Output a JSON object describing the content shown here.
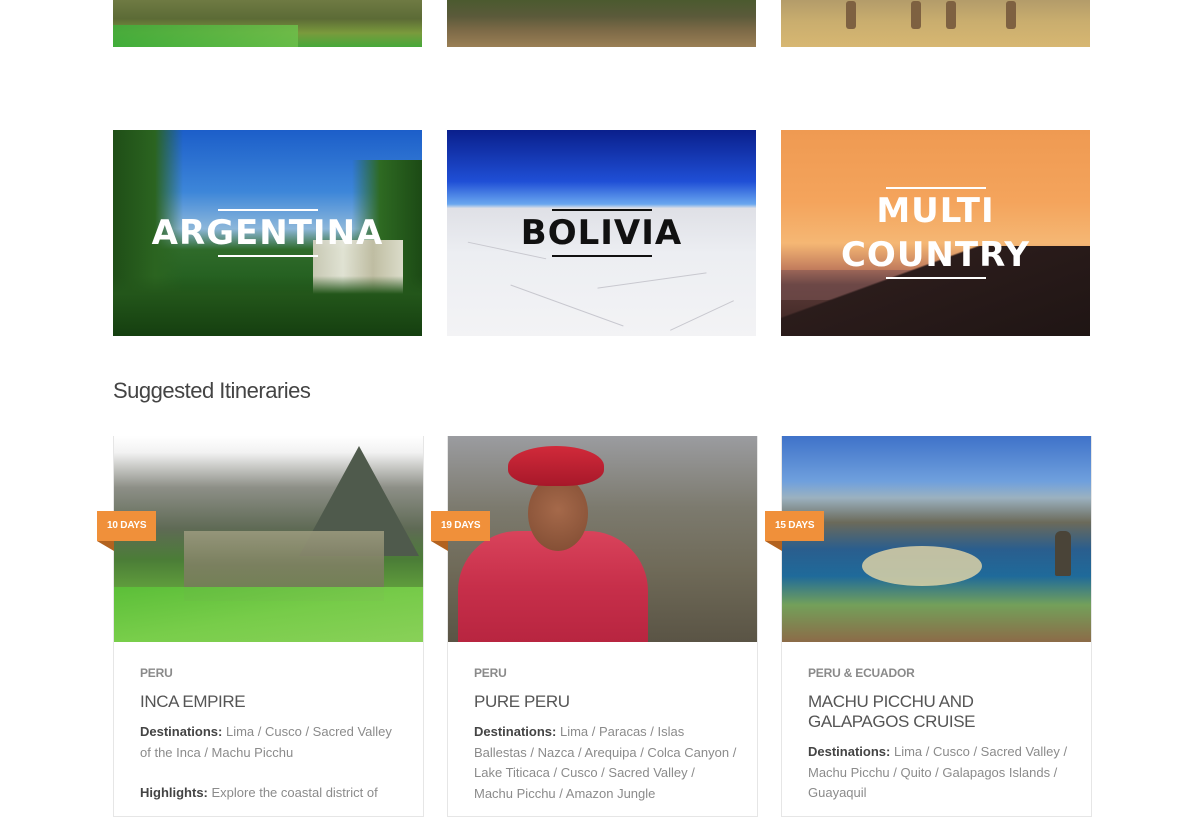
{
  "destinations": [
    {
      "name": "ARGENTINA"
    },
    {
      "name": "BOLIVIA"
    },
    {
      "name": "MULTI COUNTRY"
    }
  ],
  "section_title": "Suggested Itineraries",
  "itineraries": [
    {
      "days": "10 DAYS",
      "region": "PERU",
      "title": "INCA EMPIRE",
      "destinations_label": "Destinations:",
      "destinations": "Lima / Cusco / Sacred Valley of the Inca / Machu Picchu",
      "highlights_label": "Highlights:",
      "highlights": "Explore the coastal district of"
    },
    {
      "days": "19 DAYS",
      "region": "PERU",
      "title": "PURE PERU",
      "destinations_label": "Destinations:",
      "destinations": "Lima / Paracas / Islas Ballestas / Nazca / Arequipa / Colca Canyon / Lake Titicaca / Cusco / Sacred Valley / Machu Picchu / Amazon Jungle"
    },
    {
      "days": "15 DAYS",
      "region": "PERU & ECUADOR",
      "title": "MACHU PICCHU AND GALAPAGOS CRUISE",
      "destinations_label": "Destinations:",
      "destinations": "Lima / Cusco / Sacred Valley / Machu Picchu / Quito / Galapagos Islands / Guayaquil"
    }
  ],
  "colors": {
    "ribbon": "#f0903a",
    "ribbon_fold": "#b2621f",
    "heading": "#444444",
    "body_text": "#8b8b8b"
  }
}
